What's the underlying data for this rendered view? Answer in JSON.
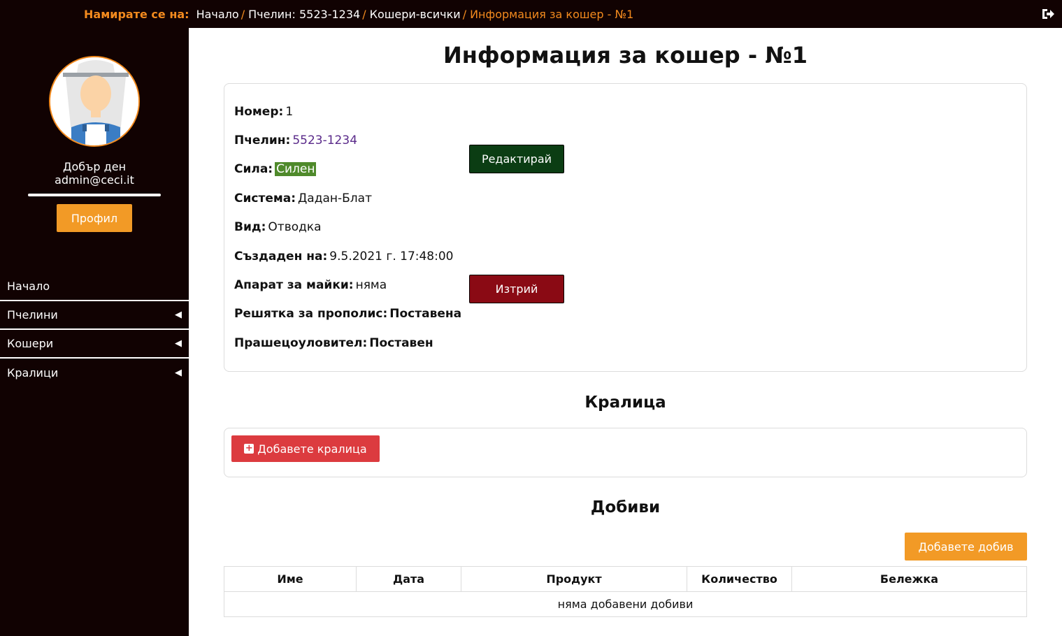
{
  "breadcrumb": {
    "lead": "Намирате се на:",
    "items": [
      "Начало",
      "Пчелин: 5523-1234",
      "Кошери-всички"
    ],
    "separator": "/",
    "active": "Информация за кошер - №1"
  },
  "sidebar": {
    "greeting": "Добър ден",
    "user": "admin@ceci.it",
    "profile_button": "Профил",
    "nav": [
      {
        "label": "Начало",
        "icon": ""
      },
      {
        "label": "Пчелини",
        "icon": "chevron-left-icon"
      },
      {
        "label": "Кошери",
        "icon": "chevron-left-icon"
      },
      {
        "label": "Кралици",
        "icon": "chevron-left-icon"
      }
    ]
  },
  "main": {
    "title": "Информация за кошер - №1",
    "info": {
      "number_label": "Номер:",
      "number_value": "1",
      "apiary_label": "Пчелин:",
      "apiary_value": "5523-1234",
      "strength_label": "Сила:",
      "strength_value": "Силен",
      "system_label": "Система:",
      "system_value": "Дадан-Блат",
      "type_label": "Вид:",
      "type_value": "Отводка",
      "created_label": "Създаден на:",
      "created_value": "9.5.2021 г. 17:48:00",
      "queen_device_label": "Апарат за майки:",
      "queen_device_value": "няма",
      "propolis_label": "Решятка за прополис:",
      "propolis_value": "Поставена",
      "pollen_label": "Прашецоуловител:",
      "pollen_value": "Поставен",
      "edit_button": "Редактирай",
      "delete_button": "Изтрий"
    },
    "queen_section": {
      "title": "Кралица",
      "add_button": "Добавете кралица"
    },
    "yields_section": {
      "title": "Добиви",
      "add_button": "Добавете добив",
      "columns": [
        "Име",
        "Дата",
        "Продукт",
        "Количество",
        "Бележка"
      ],
      "empty_text": "няма добавени добиви"
    }
  },
  "colors": {
    "accent": "#f28a1e",
    "dark_bg": "#110202",
    "edit": "#0b3d13",
    "delete": "#8a0a14",
    "add_queen": "#dc3b3f",
    "strength_tag": "#4f8a2b"
  }
}
